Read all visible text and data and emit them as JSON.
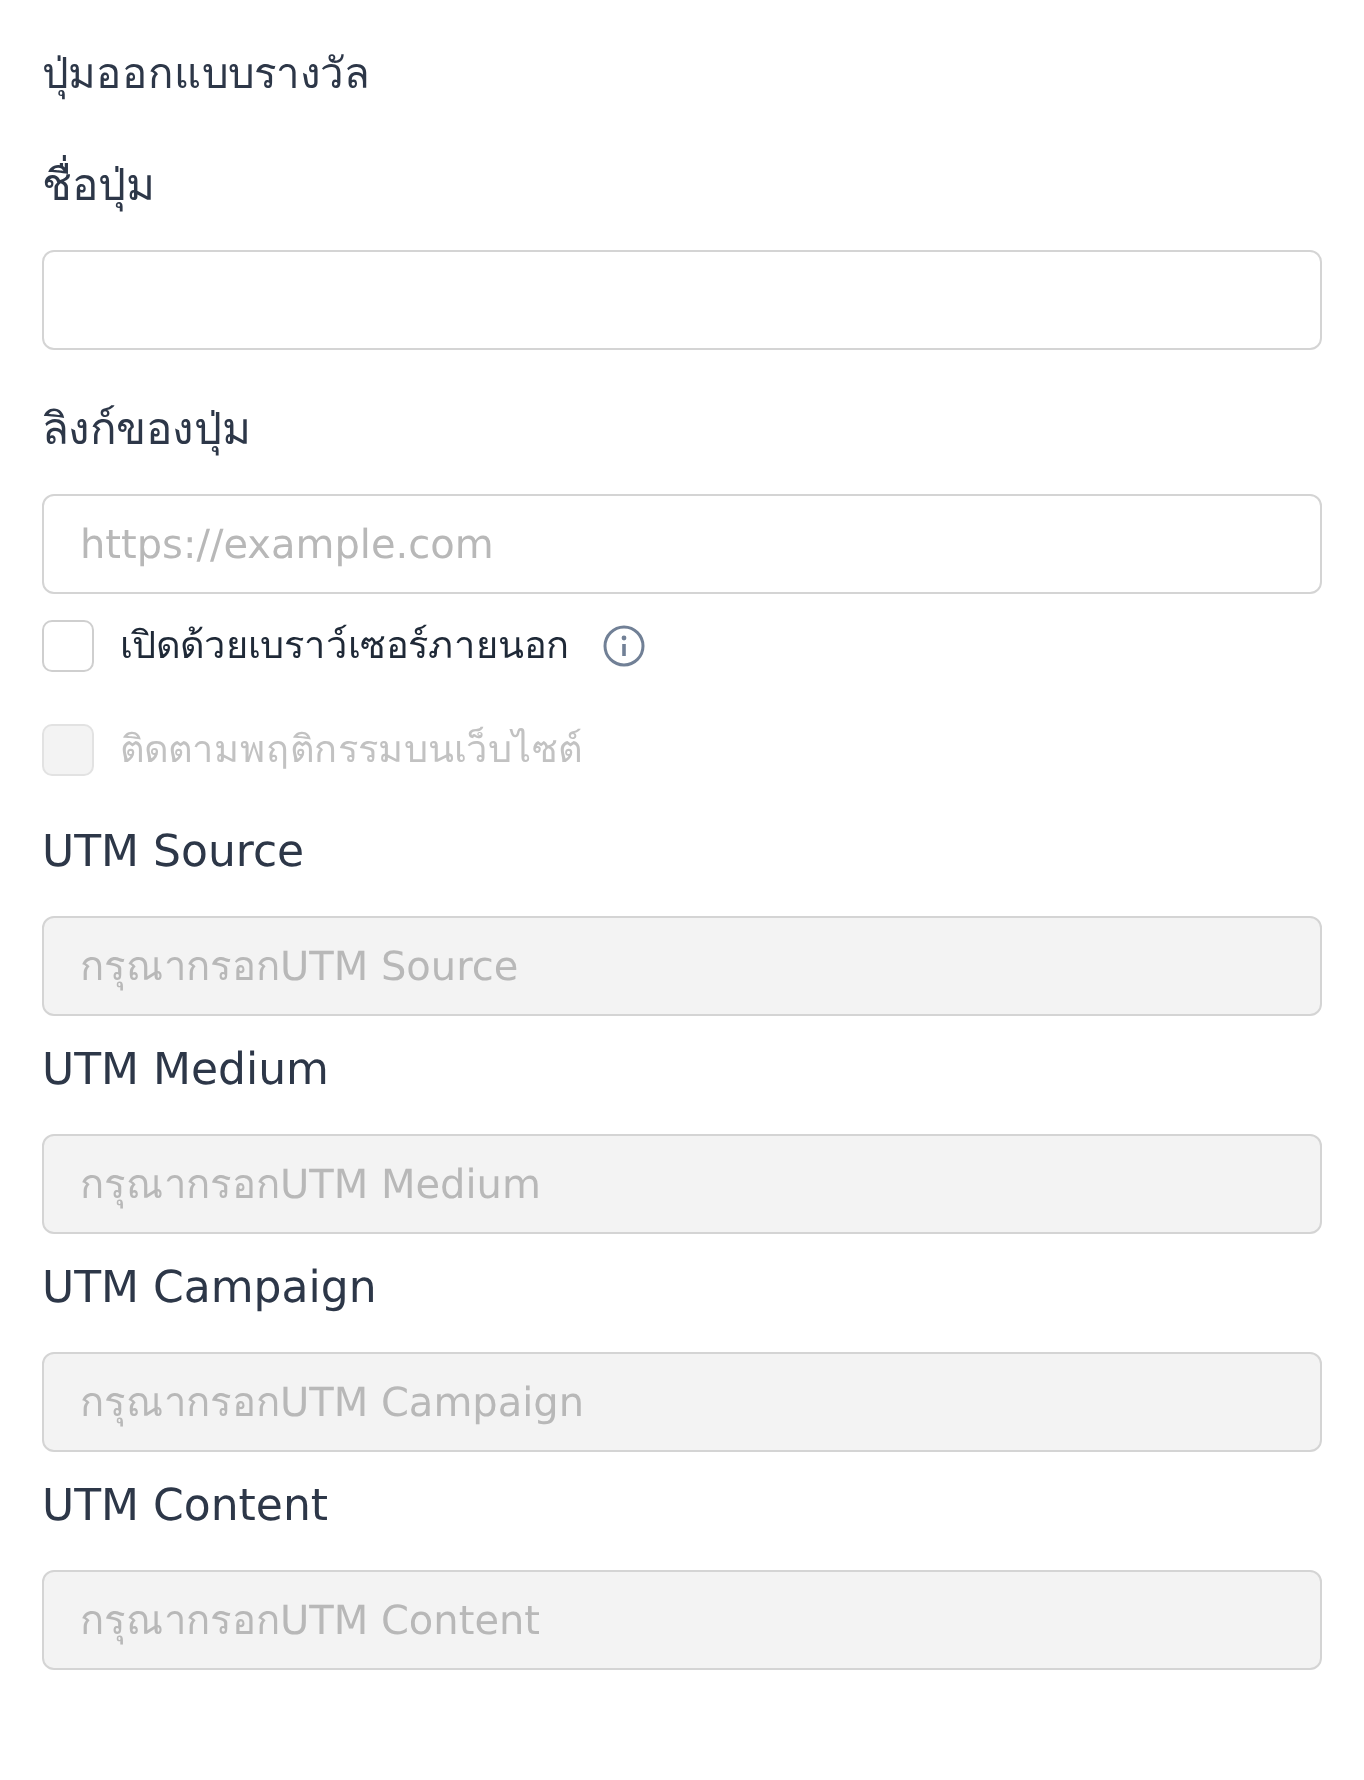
{
  "title": "ปุ่มออกแบบรางวัล",
  "items": [
    {
      "kind": "field",
      "label": "ชื่อปุ่ม",
      "disabled": false
    },
    {
      "kind": "field",
      "label": "ลิงก์ของปุ่ม",
      "placeholder": "https://example.com",
      "disabled": false
    },
    {
      "kind": "checkbox",
      "label": "เปิดด้วยเบราว์เซอร์ภายนอก",
      "checked": false,
      "disabled": false,
      "info": true
    },
    {
      "kind": "checkbox",
      "label": "ติดตามพฤติกรรมบนเว็บไซต์",
      "checked": false,
      "disabled": true
    },
    {
      "kind": "field",
      "label": "UTM Source",
      "placeholder": "กรุณากรอกUTM Source",
      "disabled": true
    },
    {
      "kind": "field",
      "label": "UTM Medium",
      "placeholder": "กรุณากรอกUTM Medium",
      "disabled": true
    },
    {
      "kind": "field",
      "label": "UTM Campaign",
      "placeholder": "กรุณากรอกUTM Campaign",
      "disabled": true
    },
    {
      "kind": "field",
      "label": "UTM Content",
      "placeholder": "กรุณากรอกUTM Content",
      "disabled": true
    }
  ]
}
